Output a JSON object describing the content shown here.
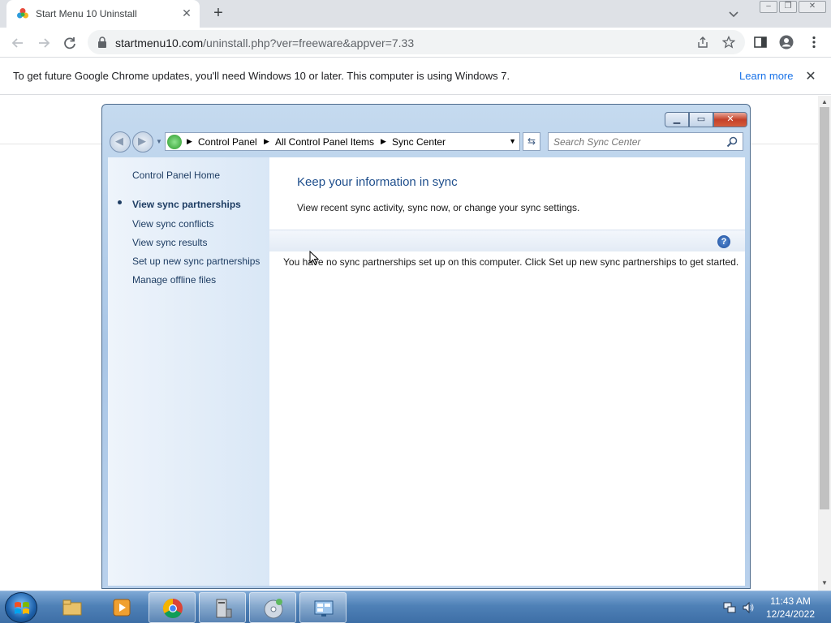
{
  "browser": {
    "tab_title": "Start Menu 10 Uninstall",
    "url_host": "startmenu10.com",
    "url_path": "/uninstall.php?ver=freeware&appver=7.33",
    "infobar_text": "To get future Google Chrome updates, you'll need Windows 10 or later. This computer is using Windows 7.",
    "learn_more": "Learn more",
    "accent": "#1a73e8"
  },
  "window": {
    "breadcrumbs": [
      "Control Panel",
      "All Control Panel Items",
      "Sync Center"
    ],
    "search_placeholder": "Search Sync Center",
    "nav": {
      "home": "Control Panel Home",
      "items": [
        "View sync partnerships",
        "View sync conflicts",
        "View sync results",
        "Set up new sync partnerships",
        "Manage offline files"
      ]
    },
    "content": {
      "title": "Keep your information in sync",
      "description": "View recent sync activity, sync now, or change your sync settings.",
      "empty_message": "You have no sync partnerships set up on this computer. Click Set up new sync partnerships to get started."
    }
  },
  "taskbar": {
    "time": "11:43 AM",
    "date": "12/24/2022",
    "icons": [
      "file-explorer-icon",
      "media-player-icon",
      "chrome-icon",
      "control-panel-icon",
      "disc-icon",
      "sync-center-icon"
    ]
  }
}
